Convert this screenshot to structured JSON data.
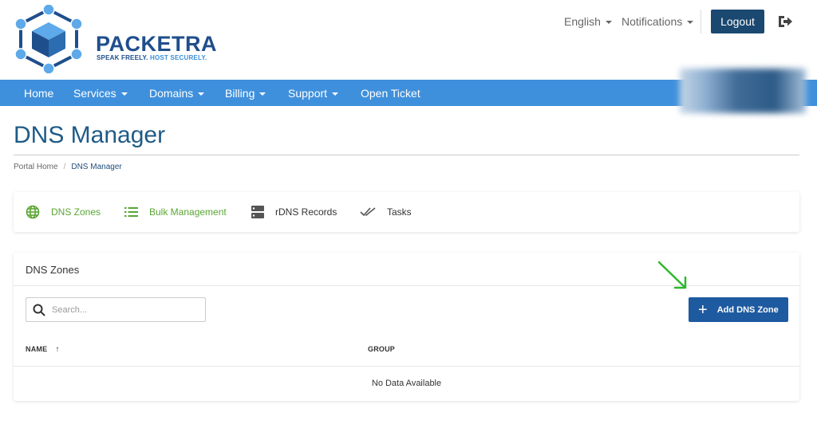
{
  "header": {
    "logo_text": "PACKETRA",
    "logo_tag_a": "SPEAK FREELY.",
    "logo_tag_b": "HOST SECURELY.",
    "language": "English",
    "notifications": "Notifications",
    "logout": "Logout",
    "exit_icon": "sign-out-icon"
  },
  "nav": {
    "items": [
      {
        "label": "Home"
      },
      {
        "label": "Services"
      },
      {
        "label": "Domains"
      },
      {
        "label": "Billing"
      },
      {
        "label": "Support"
      },
      {
        "label": "Open Ticket"
      }
    ]
  },
  "page": {
    "title": "DNS Manager",
    "breadcrumb": [
      "Portal Home",
      "DNS Manager"
    ]
  },
  "tabs": [
    {
      "label": "DNS Zones",
      "icon": "globe-icon",
      "active": true
    },
    {
      "label": "Bulk Management",
      "icon": "list-icon",
      "active": false
    },
    {
      "label": "rDNS Records",
      "icon": "server-icon",
      "active": false
    },
    {
      "label": "Tasks",
      "icon": "double-check-icon",
      "active": false
    }
  ],
  "zones": {
    "heading": "DNS Zones",
    "search_placeholder": "Search...",
    "add_button": "Add DNS Zone",
    "columns": [
      "NAME",
      "GROUP"
    ],
    "sort_indicator": "↑",
    "empty_message": "No Data Available"
  },
  "colors": {
    "brand": "#1f4e8c",
    "nav_bg": "#3f90dc",
    "active_tab": "#5aa634",
    "button": "#1e5aa0",
    "arrow": "#2db82d"
  }
}
